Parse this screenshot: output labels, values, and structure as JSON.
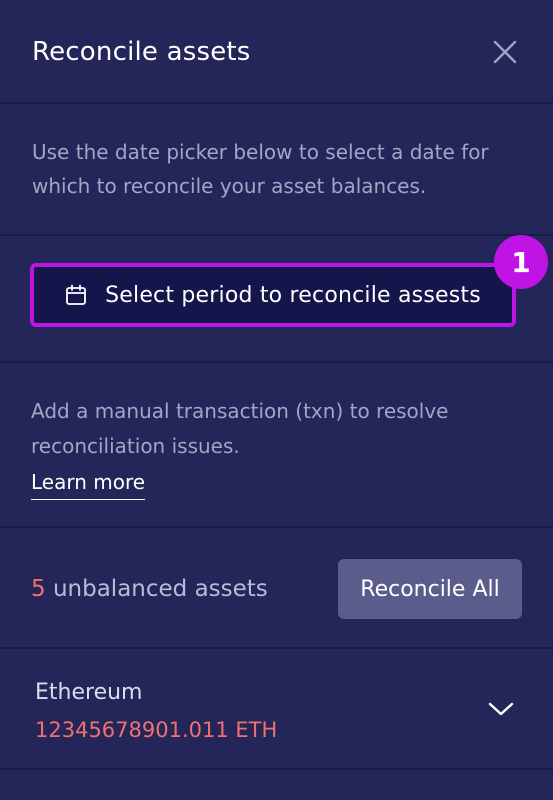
{
  "header": {
    "title": "Reconcile assets"
  },
  "intro": {
    "text": "Use the date picker below to select a date for which to reconcile your asset balances."
  },
  "period": {
    "label": "Select period to reconcile assests",
    "badge": "1"
  },
  "manual": {
    "text": "Add a manual transaction (txn) to resolve reconciliation issues.",
    "link": "Learn more"
  },
  "summary": {
    "count": "5",
    "label": "unbalanced assets",
    "button": "Reconcile All"
  },
  "asset": {
    "name": "Ethereum",
    "amount": "12345678901.011 ETH"
  },
  "colors": {
    "background": "#242659",
    "highlight": "#c013e6",
    "warning": "#f07070",
    "button": "#5a5c8b"
  },
  "icons": {
    "close": "close-icon",
    "calendar": "calendar-icon",
    "expand": "chevron-down-icon"
  }
}
